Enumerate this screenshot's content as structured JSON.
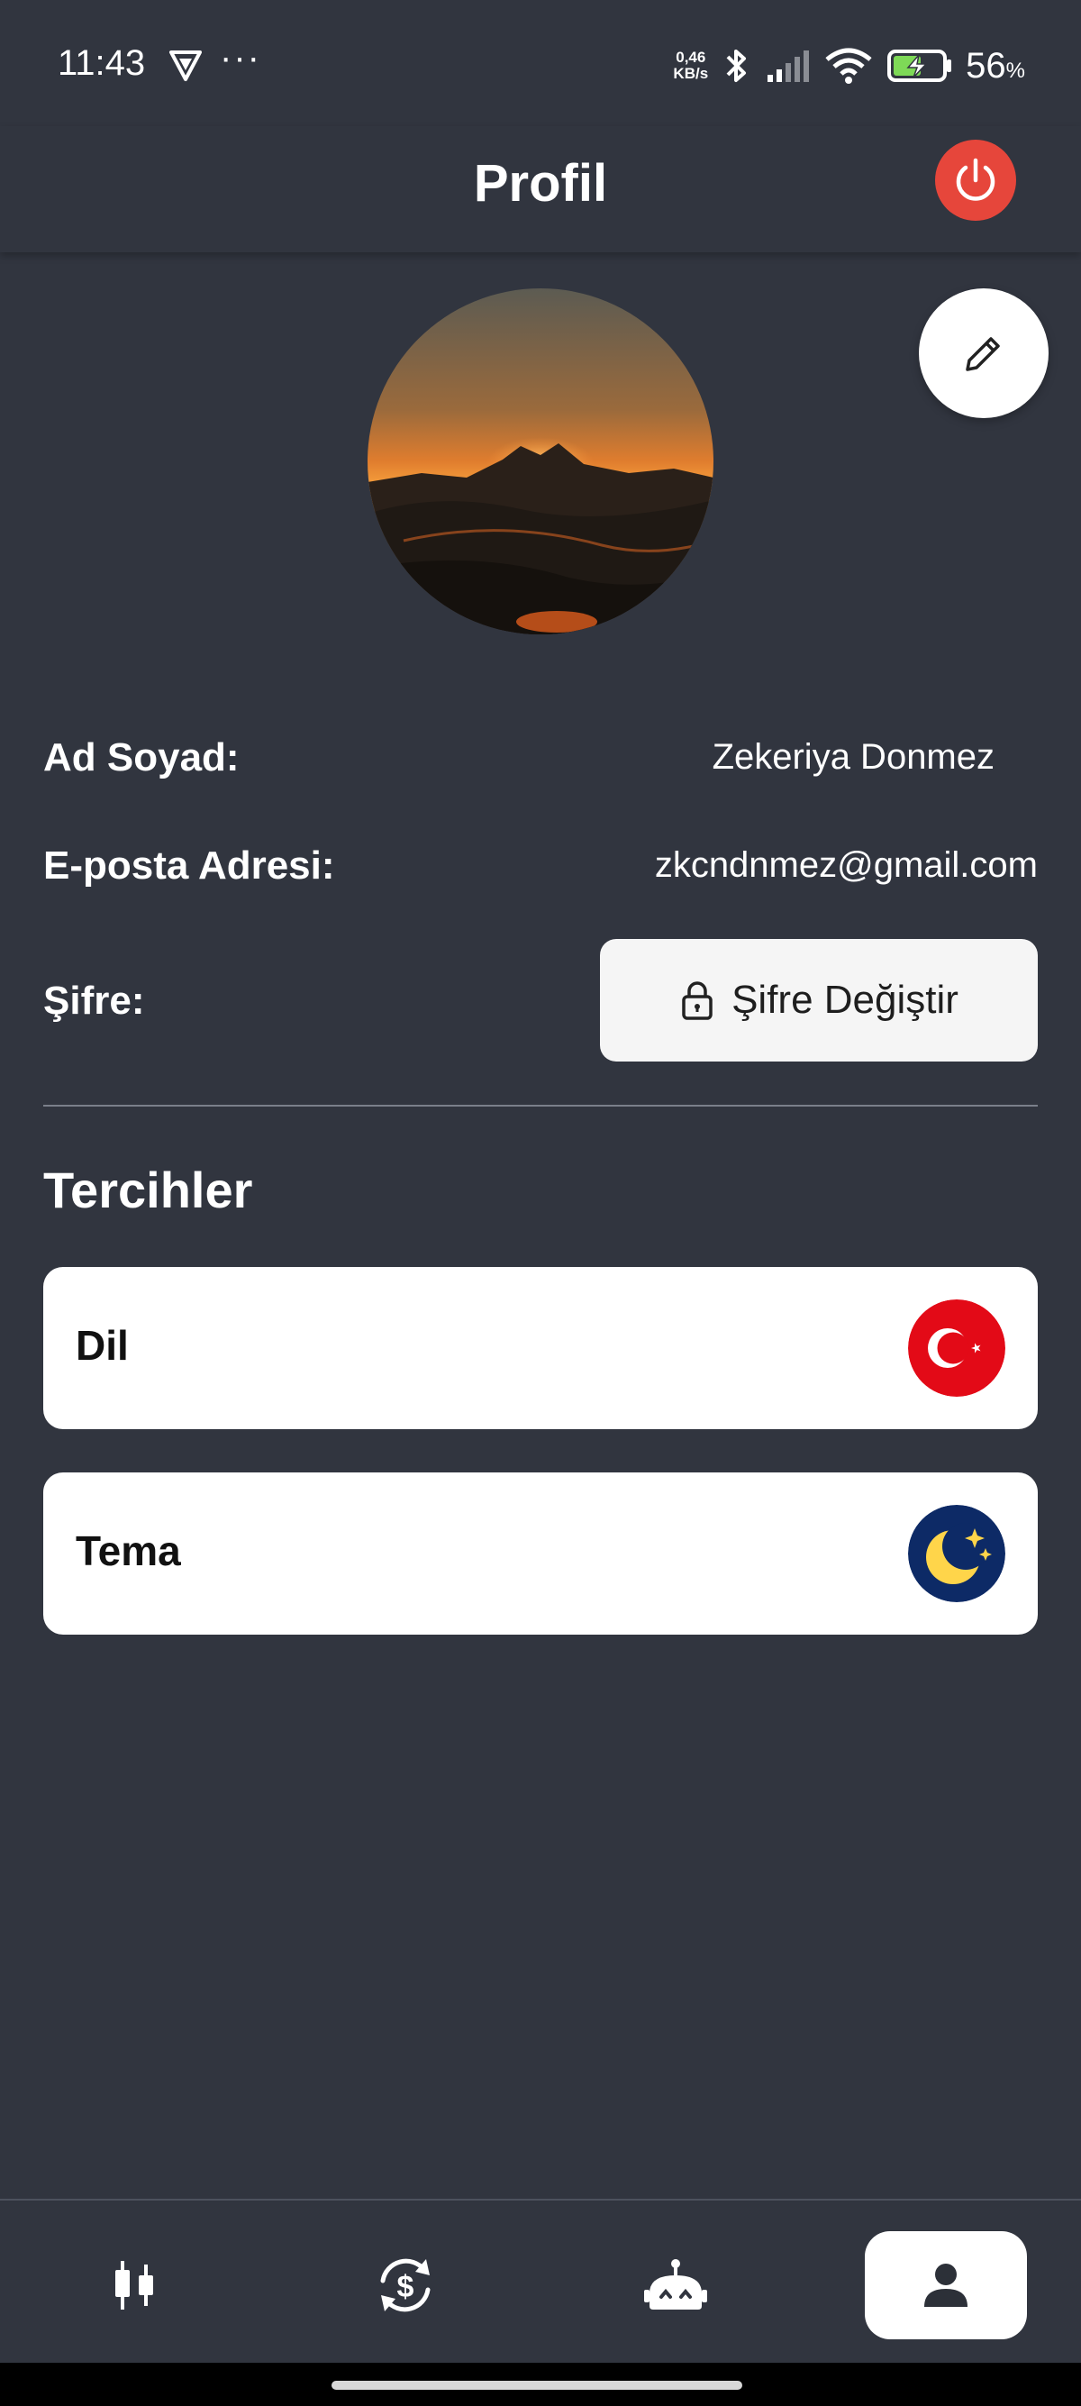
{
  "status_bar": {
    "time": "11:43",
    "dots": "···",
    "net_speed_value": "0,46",
    "net_speed_unit": "KB/s",
    "battery_percent": "56",
    "battery_unit": "%"
  },
  "header": {
    "title": "Profil"
  },
  "profile": {
    "name_label": "Ad Soyad:",
    "name_value": "Zekeriya Donmez",
    "email_label": "E-posta Adresi:",
    "email_value": "zkcndnmez@gmail.com",
    "password_label": "Şifre:",
    "change_password_button": "Şifre Değiştir"
  },
  "preferences": {
    "title": "Tercihler",
    "items": [
      {
        "label": "Dil",
        "icon": "turkey-flag-icon"
      },
      {
        "label": "Tema",
        "icon": "moon-stars-icon"
      }
    ]
  },
  "bottom_nav": {
    "items": [
      {
        "icon": "candlestick-chart-icon",
        "active": false
      },
      {
        "icon": "currency-exchange-icon",
        "active": false
      },
      {
        "icon": "robot-icon",
        "active": false
      },
      {
        "icon": "user-icon",
        "active": true
      }
    ]
  },
  "colors": {
    "background": "#31353f",
    "power_button": "#e6463b",
    "card": "#ffffff",
    "flag_red": "#e30a17",
    "moon_bg": "#0d2a66",
    "moon_yellow": "#ffd54a"
  }
}
